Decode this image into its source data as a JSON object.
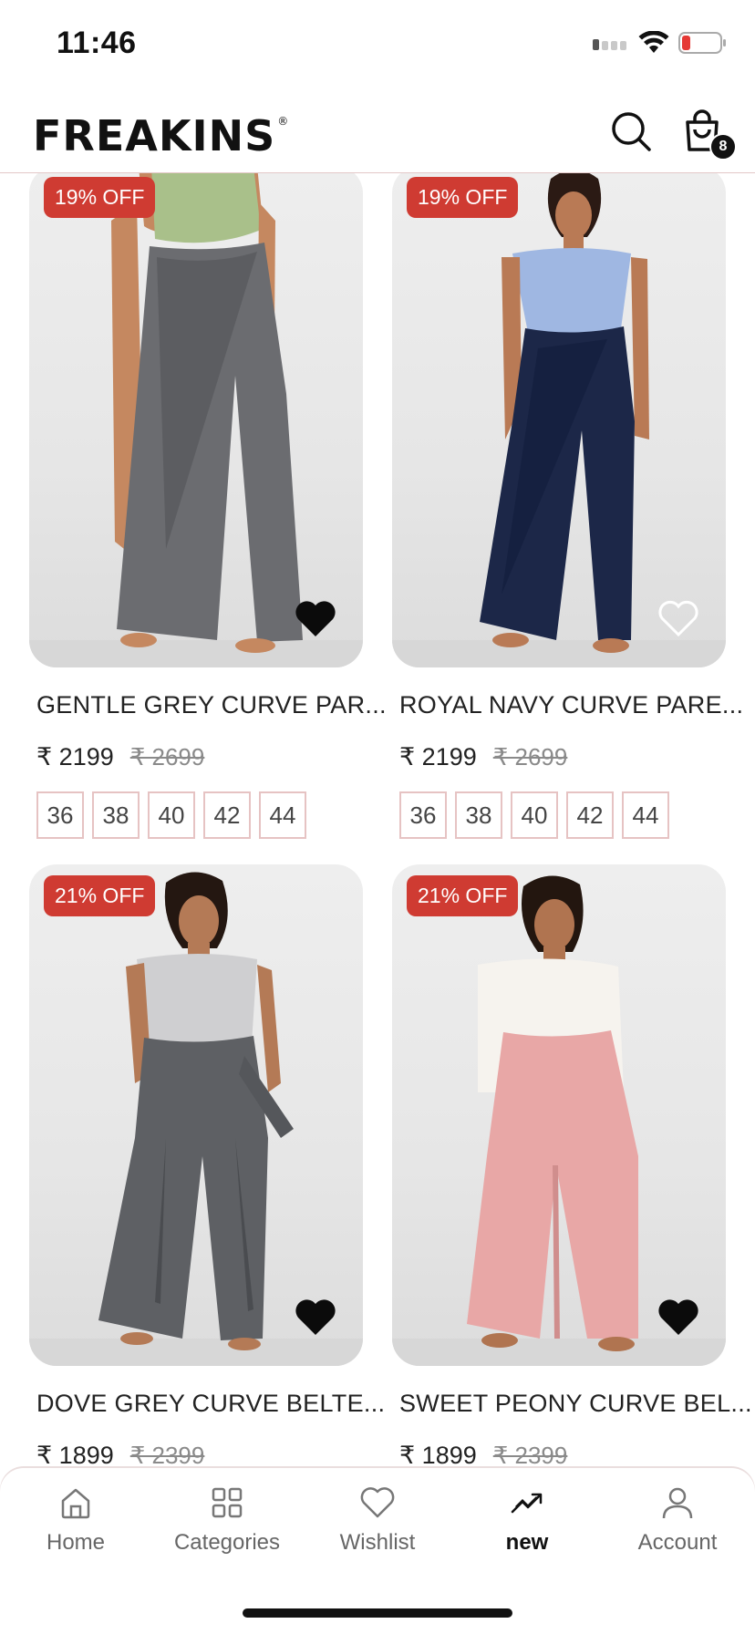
{
  "status_bar": {
    "time": "11:46"
  },
  "header": {
    "logo": "FREAKINS",
    "cart_count": "8"
  },
  "products": [
    {
      "discount": "19% OFF",
      "name": "GENTLE GREY CURVE PAR...",
      "price": "₹ 2199",
      "mrp": "₹ 2699",
      "sizes": [
        "36",
        "38",
        "40",
        "42",
        "44"
      ],
      "wishlisted": true,
      "top_color": "#a9c08a",
      "pant_color": "#6b6c70",
      "skin": "#c68a63"
    },
    {
      "discount": "19% OFF",
      "name": "ROYAL NAVY CURVE PARE...",
      "price": "₹ 2199",
      "mrp": "₹ 2699",
      "sizes": [
        "36",
        "38",
        "40",
        "42",
        "44"
      ],
      "wishlisted": false,
      "top_color": "#9fb7e2",
      "pant_color": "#1c2748",
      "skin": "#b97a55"
    },
    {
      "discount": "21% OFF",
      "name": "DOVE GREY CURVE BELTE...",
      "price": "₹ 1899",
      "mrp": "₹ 2399",
      "sizes": [],
      "wishlisted": true,
      "top_color": "#cfcfd1",
      "pant_color": "#5e6064",
      "skin": "#b47a56"
    },
    {
      "discount": "21% OFF",
      "name": "SWEET PEONY CURVE BEL...",
      "price": "₹ 1899",
      "mrp": "₹ 2399",
      "sizes": [],
      "wishlisted": true,
      "top_color": "#f6f3ee",
      "pant_color": "#e8a7a6",
      "skin": "#b07450"
    }
  ],
  "bottom_nav": [
    {
      "label": "Home",
      "icon": "home-icon",
      "active": false
    },
    {
      "label": "Categories",
      "icon": "grid-icon",
      "active": false
    },
    {
      "label": "Wishlist",
      "icon": "heart-icon",
      "active": false
    },
    {
      "label": "new",
      "icon": "trending-icon",
      "active": true
    },
    {
      "label": "Account",
      "icon": "person-icon",
      "active": false
    }
  ],
  "colors": {
    "discount_badge": "#cf3b32",
    "size_border": "#e6c3c3"
  }
}
